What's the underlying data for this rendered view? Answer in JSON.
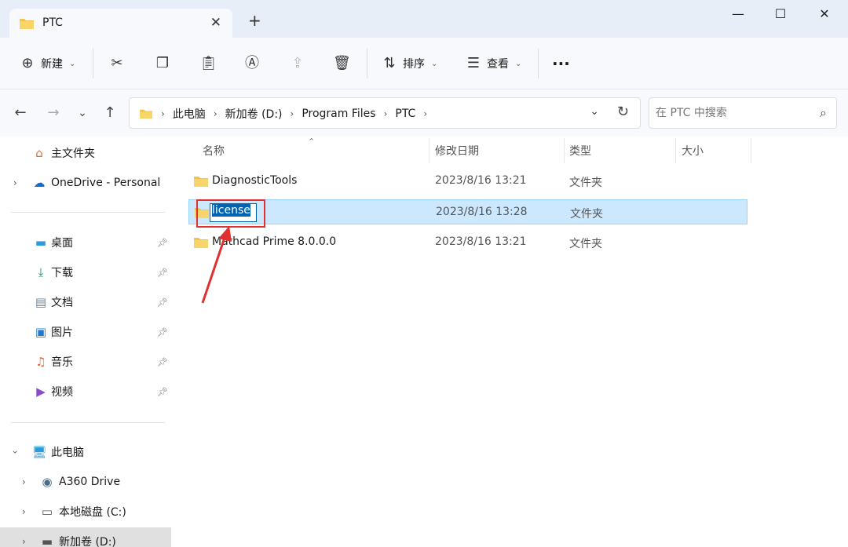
{
  "tab": {
    "title": "PTC",
    "close": "✕"
  },
  "new_tab": "+",
  "window": {
    "minimize": "—",
    "maximize": "☐",
    "close": "✕"
  },
  "toolbar": {
    "new_label": "新建",
    "sort_label": "排序",
    "view_label": "查看",
    "more": "···"
  },
  "address": {
    "crumbs": [
      "此电脑",
      "新加卷 (D:)",
      "Program Files",
      "PTC"
    ]
  },
  "search": {
    "placeholder": "在 PTC 中搜索"
  },
  "sidebar": {
    "home": "主文件夹",
    "onedrive": "OneDrive - Personal",
    "quick": [
      "桌面",
      "下载",
      "文档",
      "图片",
      "音乐",
      "视频"
    ],
    "this_pc": "此电脑",
    "drives": [
      "A360 Drive",
      "本地磁盘 (C:)",
      "新加卷 (D:)"
    ]
  },
  "columns": {
    "name": "名称",
    "date": "修改日期",
    "type": "类型",
    "size": "大小"
  },
  "files": [
    {
      "name": "DiagnosticTools",
      "date": "2023/8/16 13:21",
      "type": "文件夹"
    },
    {
      "name": "license",
      "date": "2023/8/16 13:28",
      "type": "文件夹"
    },
    {
      "name": "Mathcad Prime 8.0.0.0",
      "date": "2023/8/16 13:21",
      "type": "文件夹"
    }
  ],
  "colors": {
    "accent": "#0063b1",
    "selection": "#cce8ff",
    "annotation": "#e03030",
    "folder": "#f2c24d"
  }
}
